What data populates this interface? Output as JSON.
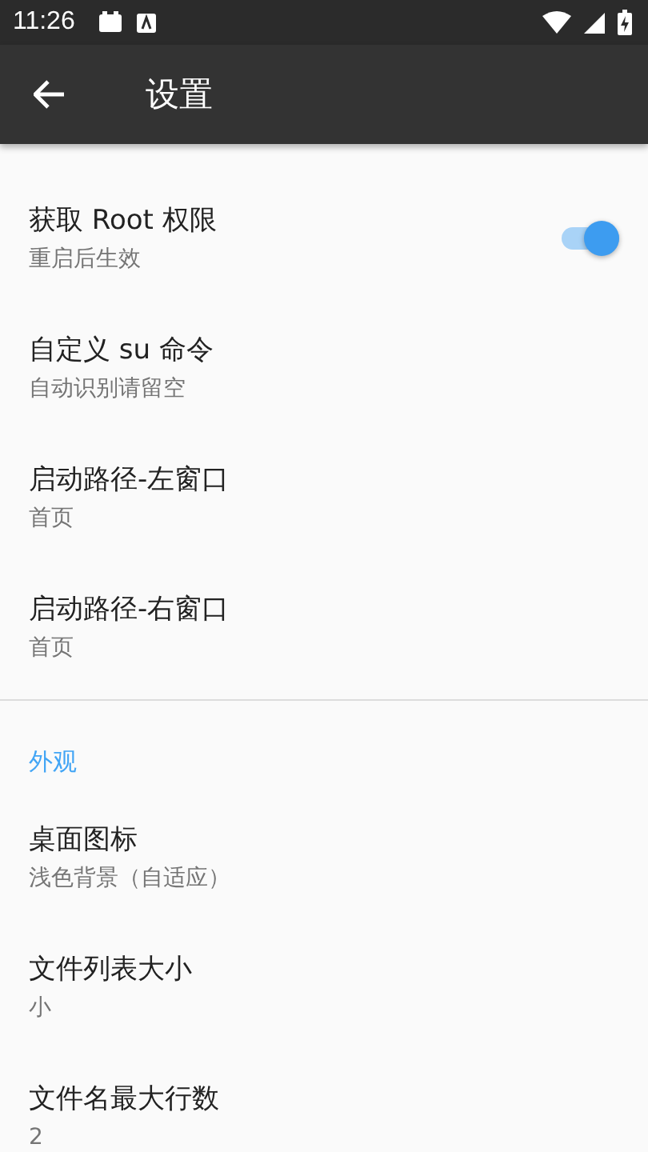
{
  "status_bar": {
    "time": "11:26"
  },
  "app_bar": {
    "title": "设置"
  },
  "sections": [
    {
      "items": [
        {
          "kind": "switch",
          "title": "获取 Root 权限",
          "subtitle": "重启后生效",
          "on": true
        },
        {
          "kind": "plain",
          "title": "自定义 su 命令",
          "subtitle": "自动识别请留空"
        },
        {
          "kind": "plain",
          "title": "启动路径-左窗口",
          "subtitle": "首页"
        },
        {
          "kind": "plain",
          "title": "启动路径-右窗口",
          "subtitle": "首页"
        }
      ]
    },
    {
      "header": "外观",
      "items": [
        {
          "kind": "plain",
          "title": "桌面图标",
          "subtitle": "浅色背景（自适应）"
        },
        {
          "kind": "plain",
          "title": "文件列表大小",
          "subtitle": "小"
        },
        {
          "kind": "plain",
          "title": "文件名最大行数",
          "subtitle": "2"
        }
      ]
    }
  ]
}
